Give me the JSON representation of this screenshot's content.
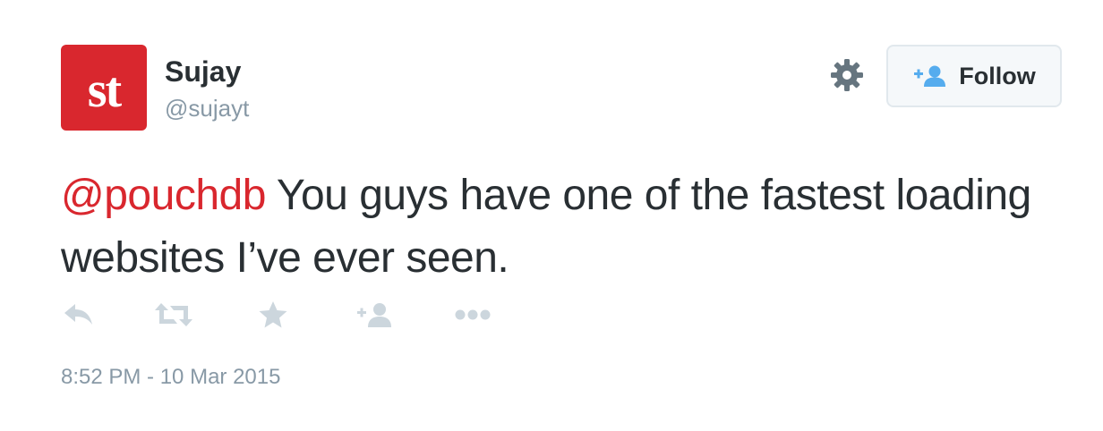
{
  "user": {
    "display_name": "Sujay",
    "handle": "@sujayt",
    "avatar_text": "st",
    "avatar_color": "#d9272e"
  },
  "follow_button": {
    "label": "Follow"
  },
  "tweet": {
    "mention": "@pouchdb",
    "body": " You guys have one of the fastest loading websites I’ve ever seen.",
    "timestamp": "8:52 PM - 10 Mar 2015"
  },
  "actions": [
    "reply-icon",
    "retweet-icon",
    "favorite-icon",
    "follow-icon",
    "more-icon"
  ],
  "colors": {
    "text": "#292f33",
    "muted": "#8899a6",
    "action_icons": "#ccd6dd",
    "mention": "#d9272e",
    "follow_icon": "#55acee"
  }
}
